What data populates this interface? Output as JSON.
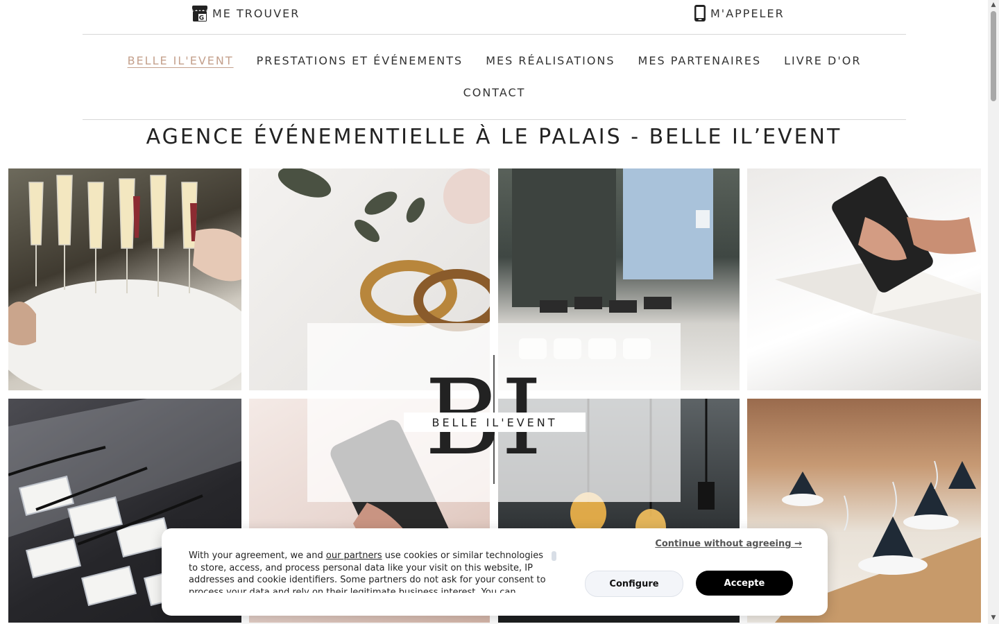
{
  "header": {
    "find_label": "ME TROUVER",
    "call_label": "M'APPELER"
  },
  "nav": {
    "items": [
      {
        "label": "BELLE IL'EVENT",
        "active": true
      },
      {
        "label": "PRESTATIONS ET ÉVÉNEMENTS"
      },
      {
        "label": "MES RÉALISATIONS"
      },
      {
        "label": "MES PARTENAIRES"
      },
      {
        "label": "LIVRE D'OR"
      },
      {
        "label": "CONTACT"
      }
    ]
  },
  "page": {
    "title": "AGENCE ÉVÉNEMENTIELLE À LE PALAIS - BELLE IL’EVENT"
  },
  "gallery": {
    "tiles": [
      {
        "name": "champagne-glasses-photo"
      },
      {
        "name": "wedding-rings-photo"
      },
      {
        "name": "catering-buffet-photo"
      },
      {
        "name": "planner-notebook-phone-photo"
      },
      {
        "name": "name-badges-photo"
      },
      {
        "name": "smartphone-hands-photo"
      },
      {
        "name": "hanging-bulbs-photo"
      },
      {
        "name": "table-setting-photo"
      }
    ]
  },
  "logo": {
    "monogram": "BI",
    "text": "BELLE IL'EVENT"
  },
  "cookie": {
    "text_before_link": "With your agreement, we and ",
    "link_text": "our partners",
    "text_after_link": " use cookies or similar technologies to store, access, and process personal data like your visit on this website, IP addresses and cookie identifiers. Some partners do not ask for your consent to process your data and rely on their legitimate business interest. You can",
    "continue_label": "Continue without agreeing →",
    "configure_label": "Configure",
    "accept_label": "Accepte"
  },
  "colors": {
    "accent": "#c4a08c",
    "text": "#333333",
    "accept_button": "#000000"
  }
}
